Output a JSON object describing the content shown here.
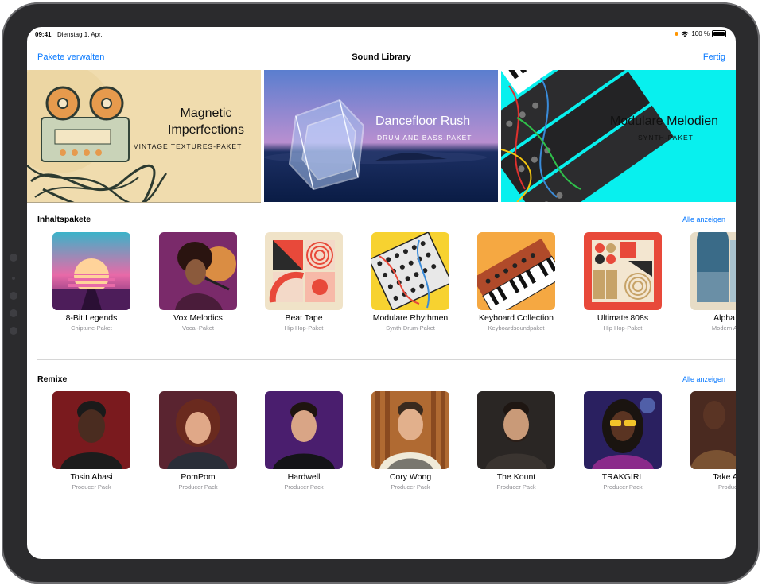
{
  "status": {
    "time": "09:41",
    "date": "Dienstag 1. Apr.",
    "battery": "100 %"
  },
  "nav": {
    "left": "Pakete verwalten",
    "title": "Sound Library",
    "right": "Fertig"
  },
  "banners": [
    {
      "title_line1": "Magnetic",
      "title_line2": "Imperfections",
      "subtitle": "VINTAGE TEXTURES-PAKET"
    },
    {
      "title": "Dancefloor Rush",
      "subtitle": "DRUM AND BASS-PAKET"
    },
    {
      "title": "Modulare Melodien",
      "subtitle": "SYNTH-PAKET"
    }
  ],
  "sections": {
    "content": {
      "heading": "Inhaltspakete",
      "link": "Alle anzeigen",
      "items": [
        {
          "name": "8-Bit Legends",
          "sub": "Chiptune-Paket"
        },
        {
          "name": "Vox Melodics",
          "sub": "Vocal-Paket"
        },
        {
          "name": "Beat Tape",
          "sub": "Hip Hop-Paket"
        },
        {
          "name": "Modulare Rhythmen",
          "sub": "Synth-Drum-Paket"
        },
        {
          "name": "Keyboard Collection",
          "sub": "Keyboardsoundpaket"
        },
        {
          "name": "Ultimate 808s",
          "sub": "Hip Hop-Paket"
        },
        {
          "name": "Alpha W",
          "sub": "Modern Ambi"
        }
      ]
    },
    "remixes": {
      "heading": "Remixe",
      "link": "Alle anzeigen",
      "items": [
        {
          "name": "Tosin Abasi",
          "sub": "Producer Pack"
        },
        {
          "name": "PomPom",
          "sub": "Producer Pack"
        },
        {
          "name": "Hardwell",
          "sub": "Producer Pack"
        },
        {
          "name": "Cory Wong",
          "sub": "Producer Pack"
        },
        {
          "name": "The Kount",
          "sub": "Producer Pack"
        },
        {
          "name": "TRAKGIRL",
          "sub": "Producer Pack"
        },
        {
          "name": "Take A D",
          "sub": "Produce"
        }
      ]
    }
  }
}
